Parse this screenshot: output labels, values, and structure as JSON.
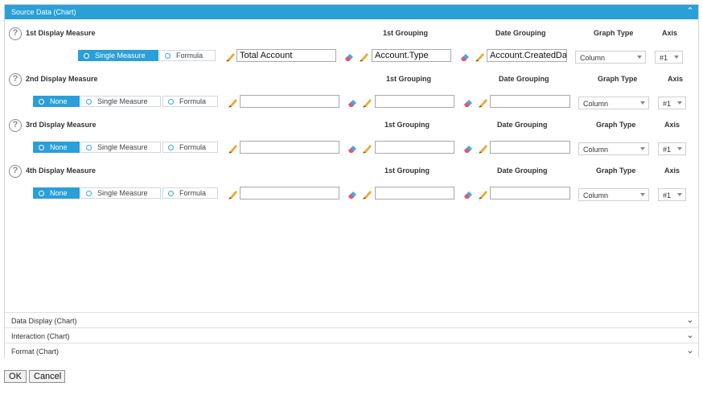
{
  "source_panel": {
    "title": "Source Data (Chart)",
    "collapse_icon": "chevron-up-icon"
  },
  "columns": {
    "grouping": "1st Grouping",
    "date_grouping": "Date Grouping",
    "graph_type": "Graph Type",
    "axis": "Axis"
  },
  "measures": [
    {
      "title": "1st Display Measure",
      "options": [
        "Single Measure",
        "Formula"
      ],
      "selected": "Single Measure",
      "measure_value": "Total Account",
      "grouping_value": "Account.Type",
      "date_grouping_value": "Account.CreatedDat",
      "graph_type": "Column",
      "axis": "#1"
    },
    {
      "title": "2nd Display Measure",
      "options": [
        "None",
        "Single Measure",
        "Formula"
      ],
      "selected": "None",
      "measure_value": "",
      "grouping_value": "",
      "date_grouping_value": "",
      "graph_type": "Column",
      "axis": "#1"
    },
    {
      "title": "3rd Display Measure",
      "options": [
        "None",
        "Single Measure",
        "Formula"
      ],
      "selected": "None",
      "measure_value": "",
      "grouping_value": "",
      "date_grouping_value": "",
      "graph_type": "Column",
      "axis": "#1"
    },
    {
      "title": "4th Display Measure",
      "options": [
        "None",
        "Single Measure",
        "Formula"
      ],
      "selected": "None",
      "measure_value": "",
      "grouping_value": "",
      "date_grouping_value": "",
      "graph_type": "Column",
      "axis": "#1"
    }
  ],
  "collapsed_sections": [
    {
      "title": "Data Display (Chart)"
    },
    {
      "title": "Interaction (Chart)"
    },
    {
      "title": "Format (Chart)"
    }
  ],
  "footer": {
    "ok_label": "OK",
    "cancel_label": "Cancel"
  },
  "colors": {
    "accent": "#2a9fd8",
    "pencil": "#f0a830",
    "eraser_blue": "#4aa8e0",
    "eraser_pink": "#e8566a"
  }
}
